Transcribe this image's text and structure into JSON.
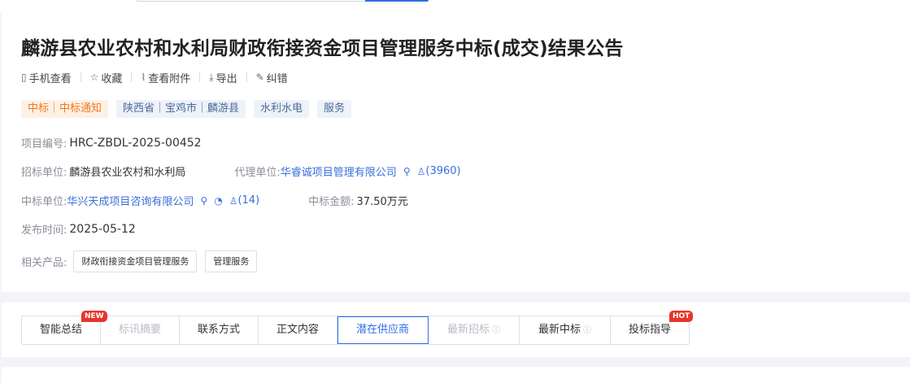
{
  "title": "麟游县农业农村和水利局财政衔接资金项目管理服务中标(成交)结果公告",
  "actions": [
    {
      "icon": "phone-icon",
      "glyph": "▯",
      "label": "手机查看"
    },
    {
      "icon": "star-icon",
      "glyph": "☆",
      "label": "收藏"
    },
    {
      "icon": "paperclip-icon",
      "glyph": "⌇",
      "label": "查看附件"
    },
    {
      "icon": "download-icon",
      "glyph": "⤓",
      "label": "导出"
    },
    {
      "icon": "edit-icon",
      "glyph": "✎",
      "label": "纠错"
    }
  ],
  "tags": {
    "type": "中标｜中标通知",
    "region": "陕西省｜宝鸡市｜麟游县",
    "industry": "水利水电",
    "category": "服务"
  },
  "info": {
    "project_no_label": "项目编号:",
    "project_no": "HRC-ZBDL-2025-00452",
    "buyer_label": "招标单位:",
    "buyer": "麟游县农业农村和水利局",
    "agent_label": "代理单位:",
    "agent": "华睿诚项目管理有限公司",
    "agent_count": "(3960)",
    "winner_label": "中标单位:",
    "winner": "华兴天成项目咨询有限公司",
    "winner_count": "(14)",
    "amount_label": "中标金额:",
    "amount": "37.50万元",
    "publish_label": "发布时间:",
    "publish_date": "2025-05-12",
    "products_label": "相关产品:",
    "products": [
      "财政衔接资金项目管理服务",
      "管理服务"
    ]
  },
  "tabs": [
    {
      "label": "智能总结",
      "badge": "NEW"
    },
    {
      "label": "标讯摘要"
    },
    {
      "label": "联系方式"
    },
    {
      "label": "正文内容"
    },
    {
      "label": "潜在供应商"
    },
    {
      "label": "最新招标"
    },
    {
      "label": "最新中标"
    },
    {
      "label": "投标指导",
      "badge": "HOT"
    }
  ],
  "colors": {
    "accent": "#2f6fe8",
    "link": "#3a6fd8",
    "orange": "#f0791f",
    "badge_red": "#e8352a"
  }
}
